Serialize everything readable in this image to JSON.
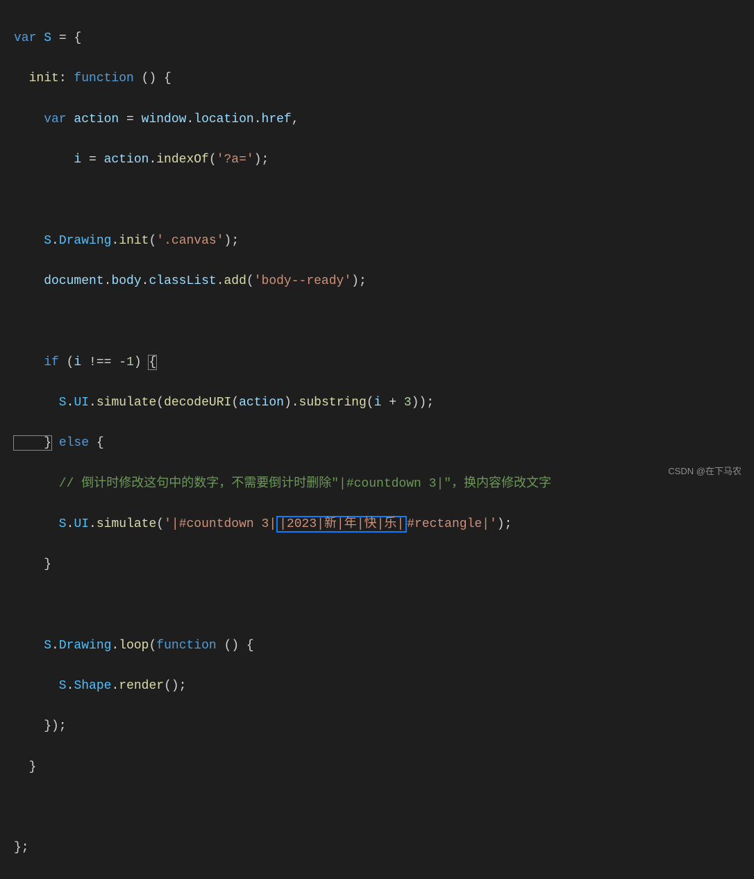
{
  "code": {
    "l01_var": "var",
    "l01_S": "S",
    "l01_eq": " = ",
    "l01_brace": "{",
    "l02_init": "  init",
    "l02_colon": ": ",
    "l02_function": "function",
    "l02_parens": " () {",
    "l03_var": "    var",
    "l03_action": " action",
    "l03_eq": " = ",
    "l03_window": "window",
    "l03_dot1": ".",
    "l03_location": "location",
    "l03_dot2": ".",
    "l03_href": "href",
    "l03_comma": ",",
    "l04_i": "        i",
    "l04_eq": " = ",
    "l04_action": "action",
    "l04_dot": ".",
    "l04_indexOf": "indexOf",
    "l04_p1": "(",
    "l04_str": "'?a='",
    "l04_p2": ");",
    "l06_S": "    S",
    "l06_dot1": ".",
    "l06_Drawing": "Drawing",
    "l06_dot2": ".",
    "l06_init": "init",
    "l06_p1": "(",
    "l06_str": "'.canvas'",
    "l06_p2": ");",
    "l07_document": "    document",
    "l07_dot1": ".",
    "l07_body": "body",
    "l07_dot2": ".",
    "l07_classList": "classList",
    "l07_dot3": ".",
    "l07_add": "add",
    "l07_p1": "(",
    "l07_str": "'body--ready'",
    "l07_p2": ");",
    "l09_if": "    if",
    "l09_p1": " (",
    "l09_i": "i",
    "l09_op": " !== ",
    "l09_neg": "-",
    "l09_num": "1",
    "l09_p2": ") ",
    "l09_brace": "{",
    "l10_S": "      S",
    "l10_dot1": ".",
    "l10_UI": "UI",
    "l10_dot2": ".",
    "l10_simulate": "simulate",
    "l10_p1": "(",
    "l10_decodeURI": "decodeURI",
    "l10_p2": "(",
    "l10_action": "action",
    "l10_p3": ").",
    "l10_substring": "substring",
    "l10_p4": "(",
    "l10_i": "i",
    "l10_plus": " + ",
    "l10_num": "3",
    "l10_p5": "));",
    "l11_brace": "    }",
    "l11_else": " else ",
    "l11_brace2": "{",
    "l12_comment": "      // 倒计时修改这句中的数字，不需要倒计时删除\"|#countdown 3|\"，换内容修改文字",
    "l13_S": "      S",
    "l13_dot1": ".",
    "l13_UI": "UI",
    "l13_dot2": ".",
    "l13_simulate": "simulate",
    "l13_p1": "(",
    "l13_str1": "'|#countdown 3|",
    "l13_hl": "|2023|新|年|快|乐|",
    "l13_str2": "#rectangle|'",
    "l13_p2": ");",
    "l14_brace": "    }",
    "l16_S": "    S",
    "l16_dot1": ".",
    "l16_Drawing": "Drawing",
    "l16_dot2": ".",
    "l16_loop": "loop",
    "l16_p1": "(",
    "l16_function": "function",
    "l16_p2": " () {",
    "l17_S": "      S",
    "l17_dot1": ".",
    "l17_Shape": "Shape",
    "l17_dot2": ".",
    "l17_render": "render",
    "l17_p3": "();",
    "l18_close": "    });",
    "l19_brace": "  }",
    "l21_close": "};"
  },
  "watermark": "CSDN @在下马农"
}
